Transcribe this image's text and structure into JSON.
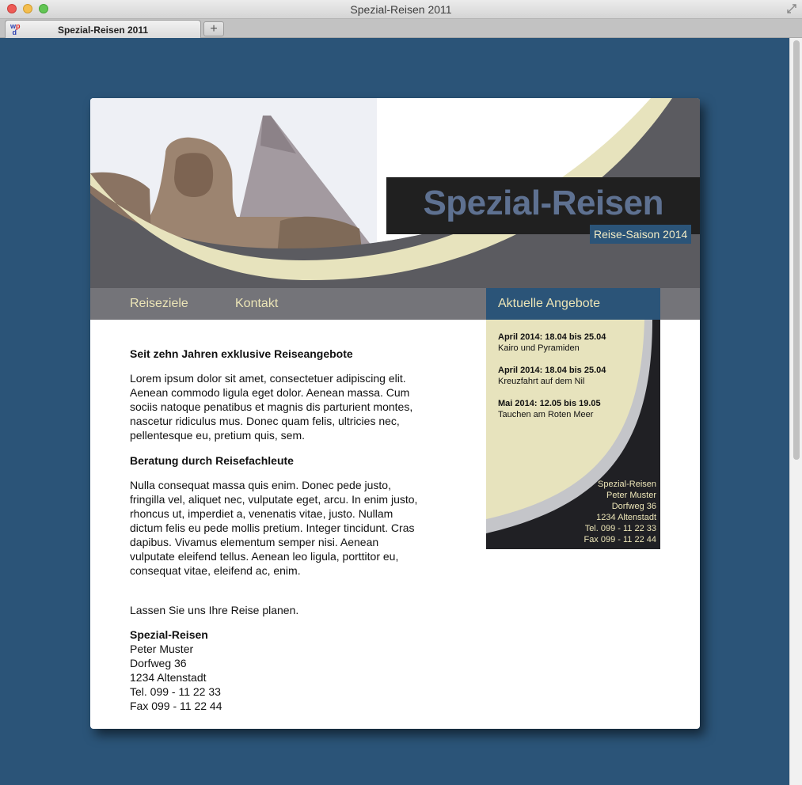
{
  "window": {
    "title": "Spezial-Reisen 2011"
  },
  "tabs": [
    {
      "label": "Spezial-Reisen 2011"
    }
  ],
  "new_tab_symbol": "+",
  "header": {
    "brand": "Spezial-Reisen",
    "season": "Reise-Saison 2014"
  },
  "nav": [
    {
      "label": "Reiseziele"
    },
    {
      "label": "Kontakt"
    }
  ],
  "sidebar": {
    "title": "Aktuelle Angebote",
    "offers": [
      {
        "date": "April 2014: 18.04 bis 25.04",
        "desc": "Kairo und Pyramiden"
      },
      {
        "date": "April 2014: 18.04 bis 25.04",
        "desc": "Kreuzfahrt auf dem Nil"
      },
      {
        "date": "Mai 2014: 12.05 bis 19.05",
        "desc": "Tauchen am Roten Meer"
      }
    ],
    "address": [
      "Spezial-Reisen",
      "Peter Muster",
      "Dorfweg 36",
      "1234 Altenstadt",
      "Tel. 099 - 11 22 33",
      "Fax 099 - 11 22 44"
    ]
  },
  "content": {
    "heading1": "Seit zehn Jahren exklusive Reiseangebote",
    "para1": "Lorem ipsum dolor sit amet, consectetuer adipiscing elit. Aenean commodo ligula eget dolor. Aenean massa. Cum sociis natoque penatibus et magnis dis parturient montes, nascetur ridiculus mus. Donec quam felis, ultricies nec, pellentesque eu, pretium quis, sem.",
    "heading2": "Beratung durch Reisefachleute",
    "para2": "Nulla consequat massa quis enim. Donec pede justo, fringilla vel, aliquet nec, vulputate eget, arcu. In enim justo, rhoncus ut, imperdiet a, venenatis vitae, justo. Nullam dictum felis eu pede mollis pretium. Integer tincidunt. Cras dapibus. Vivamus elementum semper nisi. Aenean vulputate eleifend tellus. Aenean leo ligula, porttitor eu, consequat vitae, eleifend ac, enim.",
    "closing": "Lassen Sie uns Ihre Reise planen.",
    "contact_name": "Spezial-Reisen",
    "contact_lines": [
      "Peter Muster",
      "Dorfweg 36",
      "1234 Altenstadt",
      "Tel. 099 - 11 22 33",
      "Fax 099 - 11 22 44"
    ]
  },
  "colors": {
    "desktop": "#2b5478",
    "header_gray": "#5b5b60",
    "nav_gray": "#747479",
    "cream": "#e7e3bd",
    "brand_text": "#5e7191",
    "accent_blue": "#2b5478"
  }
}
